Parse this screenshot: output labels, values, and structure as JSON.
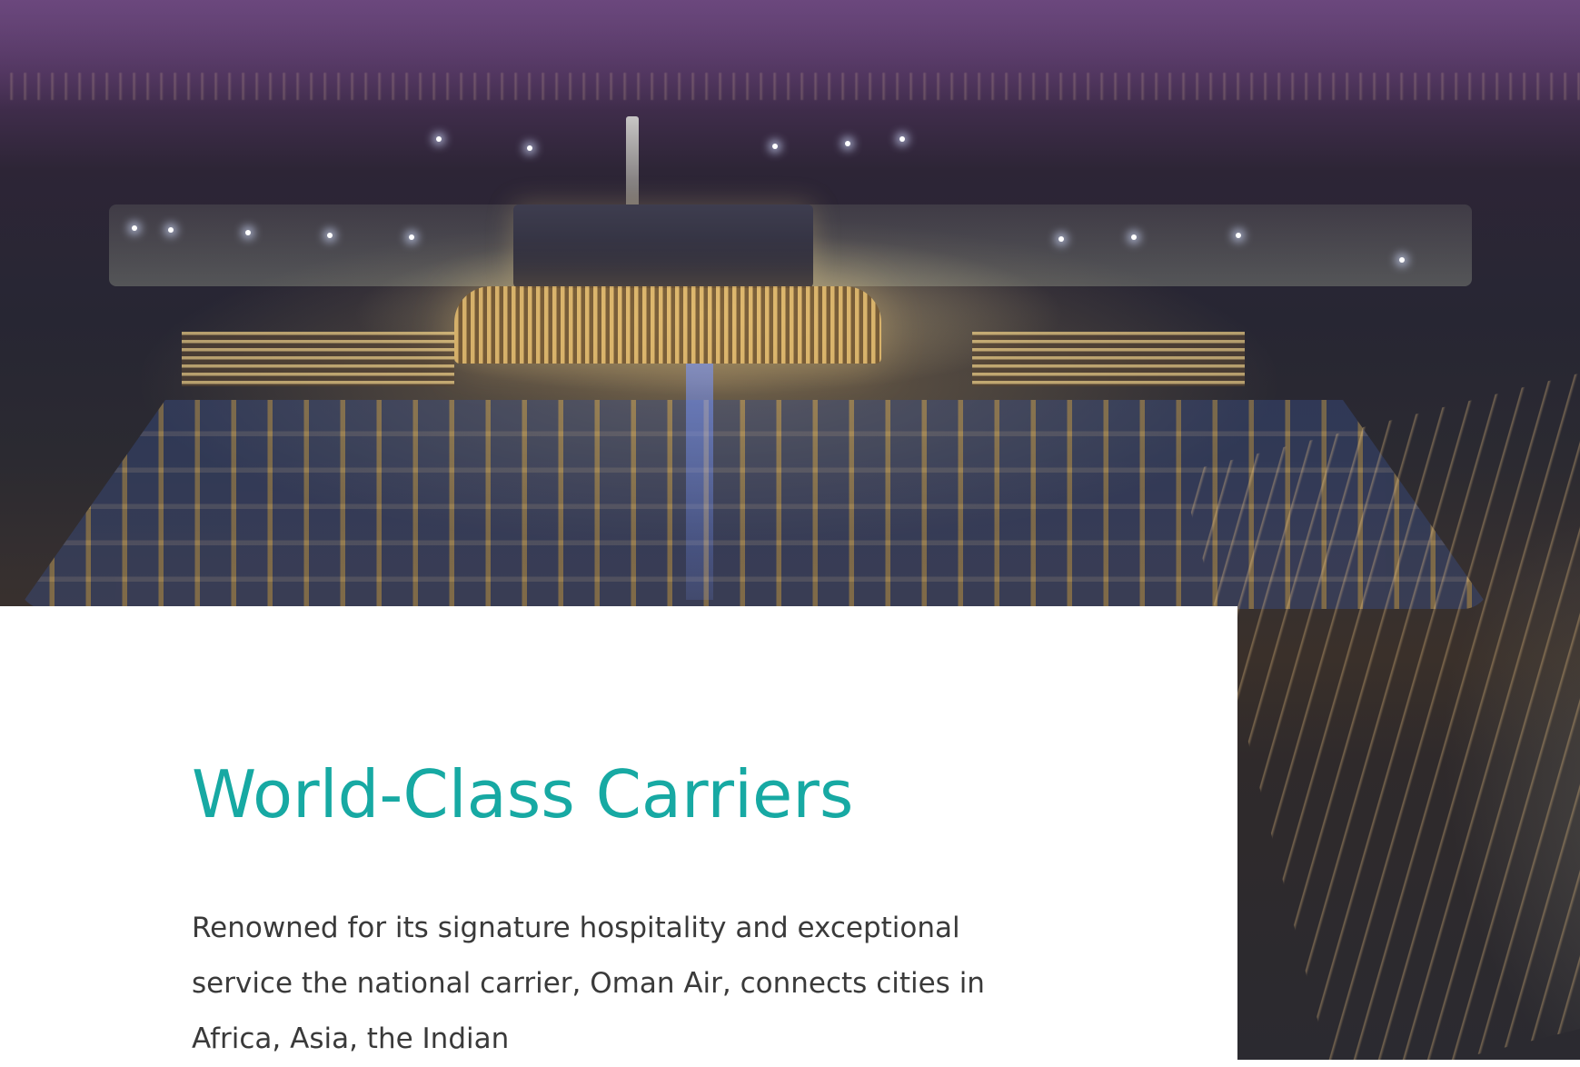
{
  "hero": {
    "image_alt": "Aerial night view of Muscat International Airport"
  },
  "section": {
    "title": "World-Class Carriers",
    "body": "Renowned for its signature hospitality and exceptional service the national carrier, Oman Air, connects cities in Africa, Asia, the Indian"
  },
  "colors": {
    "title_accent": "#17a9a3",
    "body_text": "#3a3a3a",
    "card_background": "#ffffff"
  }
}
